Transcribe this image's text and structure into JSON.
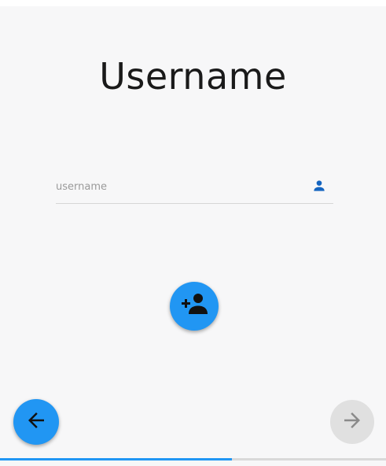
{
  "page": {
    "title": "Username"
  },
  "username_field": {
    "placeholder": "username",
    "value": "",
    "icon": "person-icon"
  },
  "actions": {
    "add_user_icon": "person-add-icon",
    "back_icon": "arrow-back-icon",
    "next_icon": "arrow-forward-icon",
    "next_enabled": false
  },
  "progress": {
    "fraction": 0.6
  },
  "colors": {
    "accent": "#2196f3",
    "field_icon": "#1565c0",
    "disabled_button": "#e0e0e0",
    "disabled_icon": "#8a8a8a",
    "background": "#f7f7f8"
  }
}
